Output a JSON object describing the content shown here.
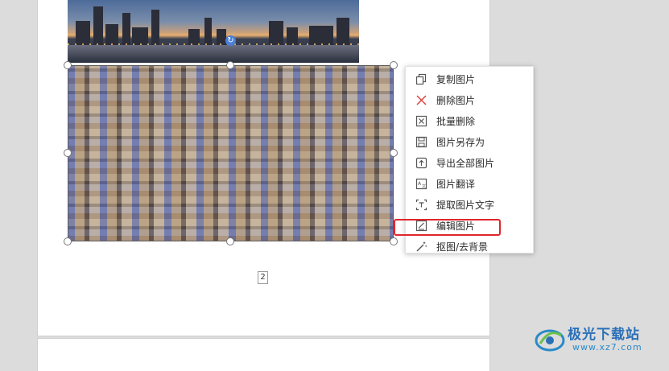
{
  "document": {
    "page_number": "2"
  },
  "context_menu": {
    "items": [
      {
        "label": "复制图片",
        "icon": "copy-icon"
      },
      {
        "label": "删除图片",
        "icon": "delete-x-icon"
      },
      {
        "label": "批量删除",
        "icon": "batch-delete-icon"
      },
      {
        "label": "图片另存为",
        "icon": "save-as-icon"
      },
      {
        "label": "导出全部图片",
        "icon": "export-icon"
      },
      {
        "label": "图片翻译",
        "icon": "translate-icon"
      },
      {
        "label": "提取图片文字",
        "icon": "extract-text-icon"
      },
      {
        "label": "编辑图片",
        "icon": "edit-image-icon"
      },
      {
        "label": "抠图/去背景",
        "icon": "magic-wand-icon"
      }
    ],
    "highlighted_item": "编辑图片",
    "highlight_color": "#e0262b"
  },
  "watermark": {
    "brand": "极光下载站",
    "url": "www.xz7.com"
  }
}
